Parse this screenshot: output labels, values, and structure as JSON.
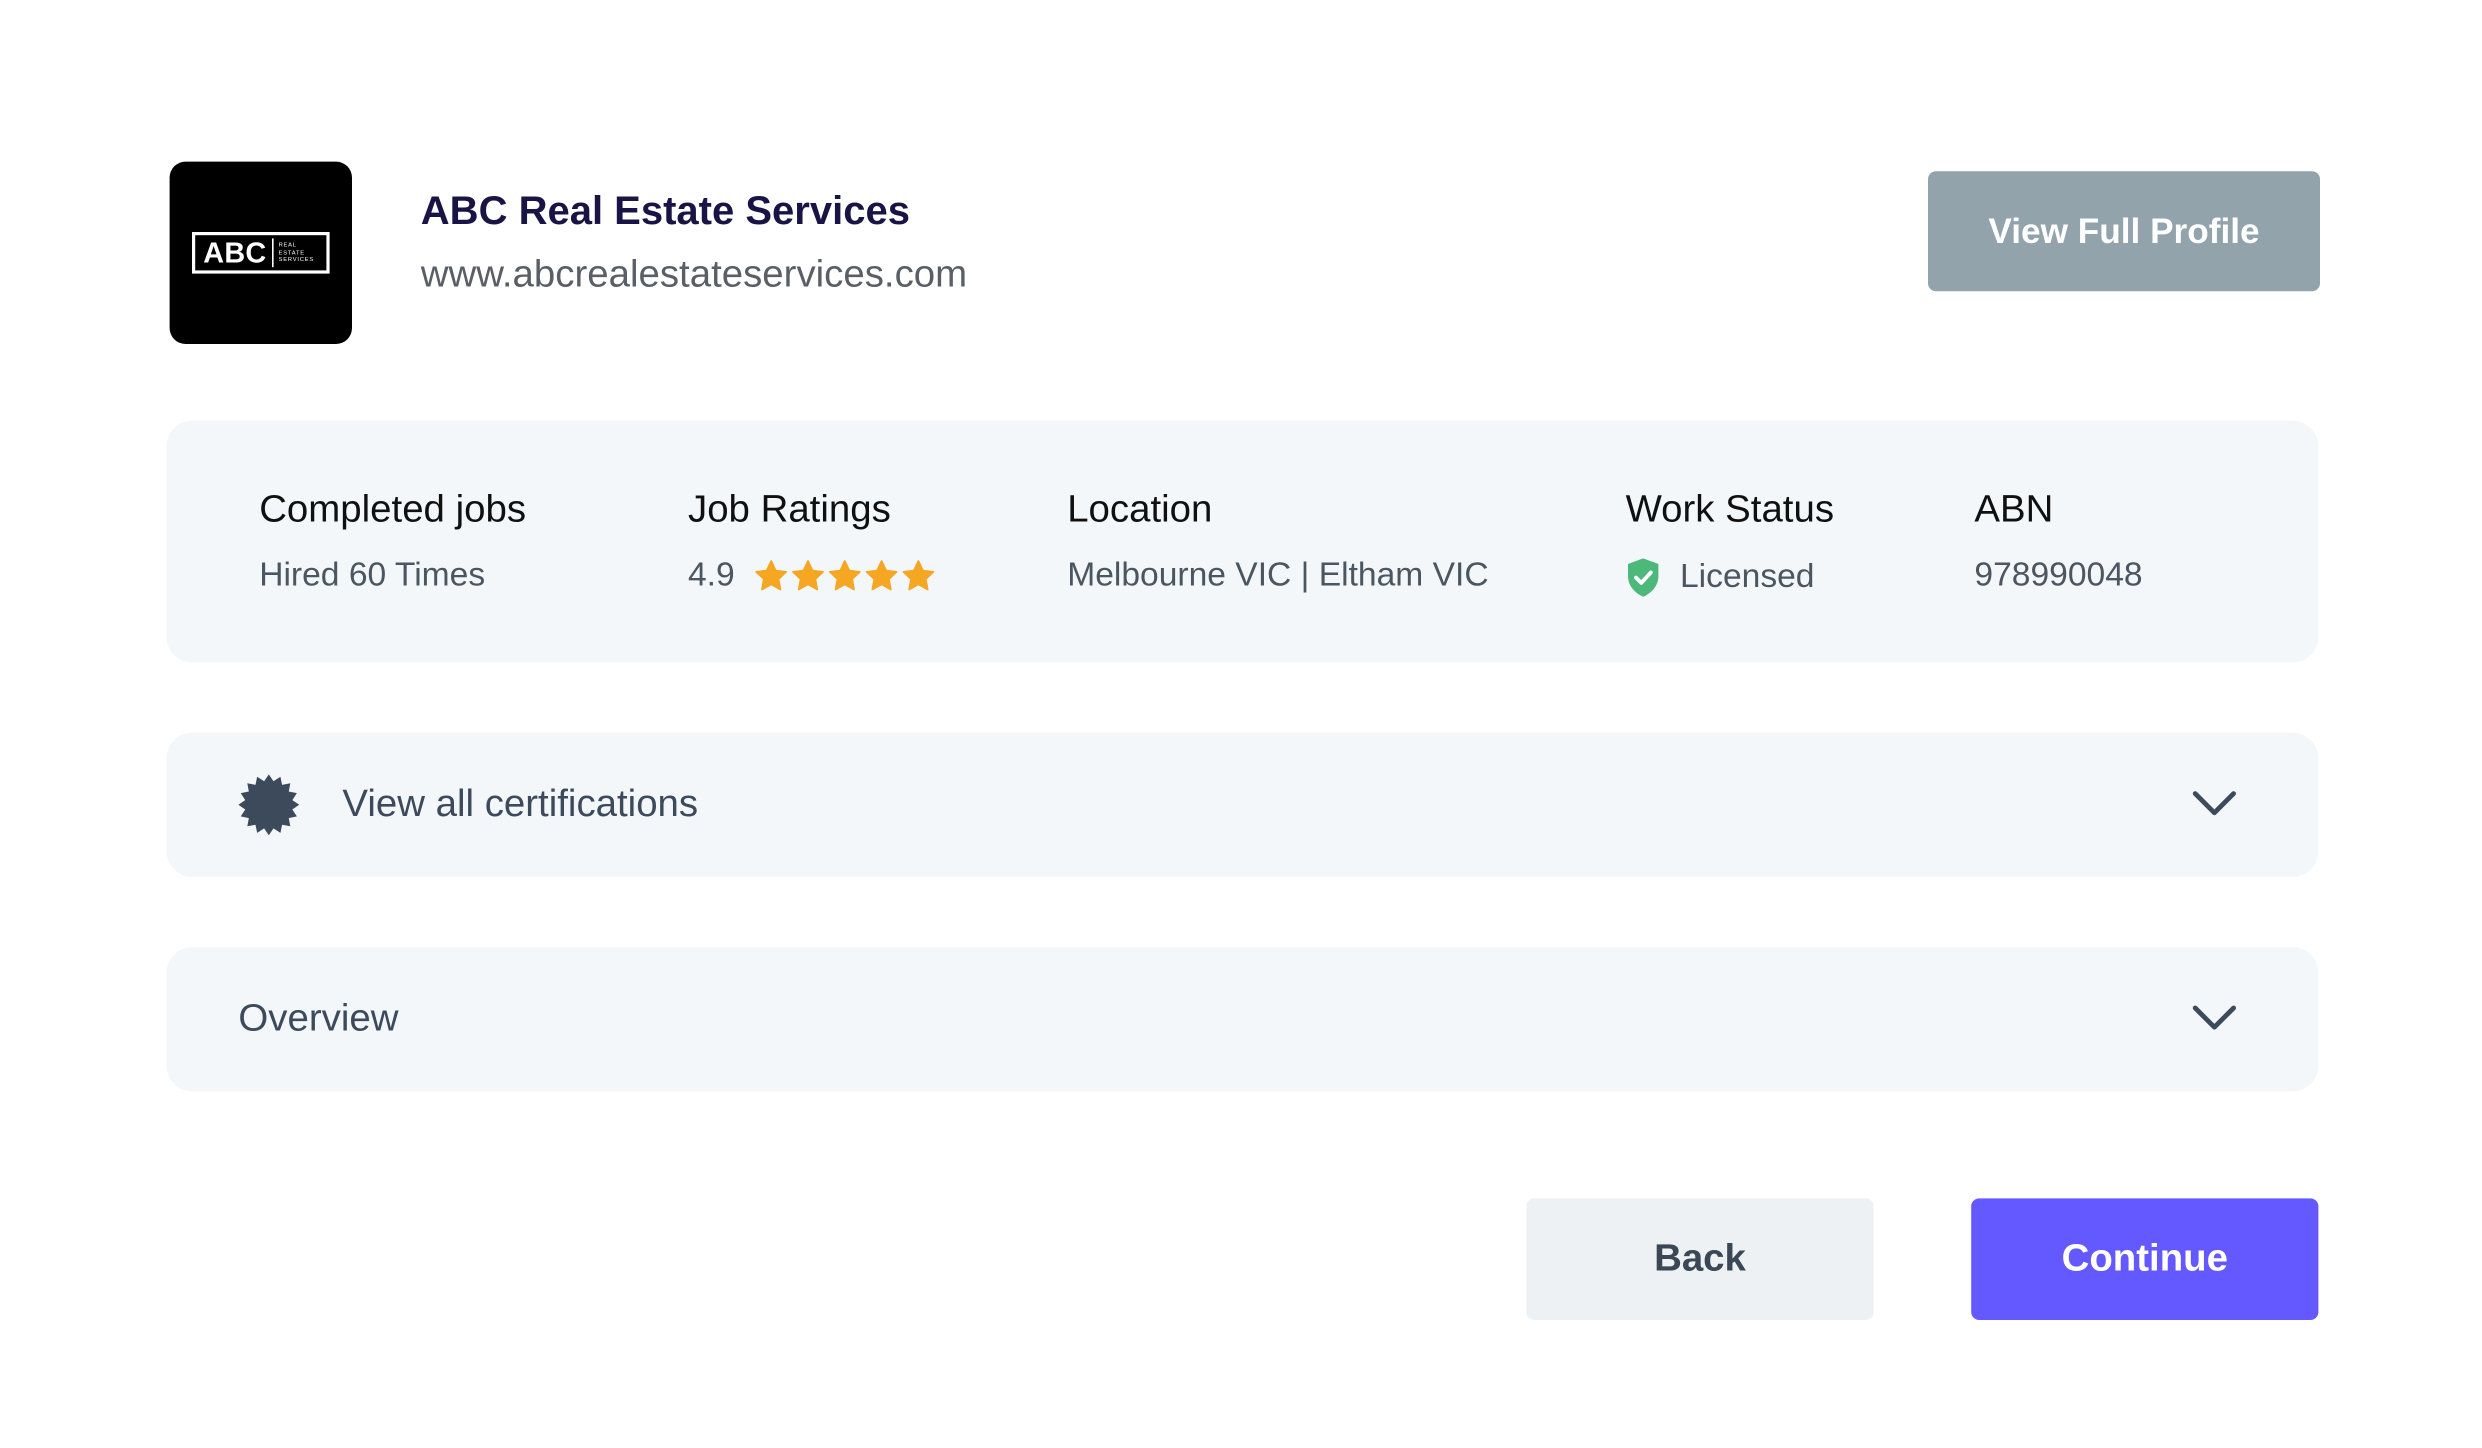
{
  "company": {
    "logo": {
      "main_text": "ABC",
      "small_lines": [
        "REAL",
        "ESTATE",
        "SERVICES"
      ]
    },
    "name": "ABC Real Estate Services",
    "website": "www.abcrealestateservices.com",
    "view_profile_label": "View Full Profile"
  },
  "stats": {
    "completed_jobs": {
      "label": "Completed jobs",
      "value": "Hired 60 Times"
    },
    "job_ratings": {
      "label": "Job Ratings",
      "value": "4.9",
      "stars": 5,
      "star_color": "#f5a623"
    },
    "location": {
      "label": "Location",
      "value": "Melbourne VIC | Eltham VIC"
    },
    "work_status": {
      "label": "Work Status",
      "value": "Licensed",
      "icon": "shield-check-icon",
      "icon_color": "#4cb87a"
    },
    "abn": {
      "label": "ABN",
      "value": "978990048"
    }
  },
  "accordions": {
    "certifications": {
      "label": "View all certifications",
      "icon": "badge-icon"
    },
    "overview": {
      "label": "Overview"
    }
  },
  "actions": {
    "back_label": "Back",
    "continue_label": "Continue"
  },
  "colors": {
    "accent": "#6459ff",
    "profile_button": "#92a3ac",
    "panel_background": "#f4f7fa",
    "company_name": "#1a1446"
  }
}
